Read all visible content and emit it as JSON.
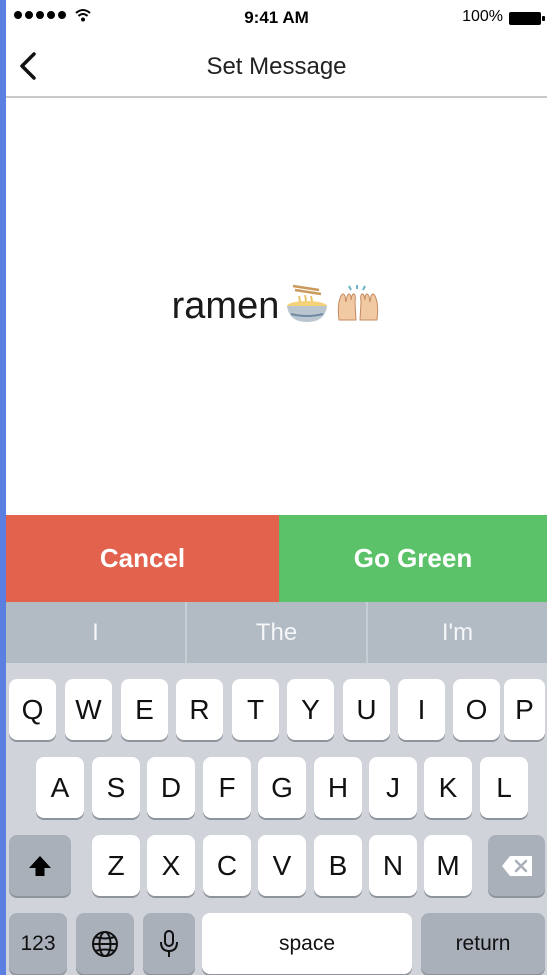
{
  "status_bar": {
    "time": "9:41 AM",
    "battery": "100%",
    "icons": [
      "signal-dots-icon",
      "wifi-icon",
      "battery-icon"
    ]
  },
  "nav": {
    "title": "Set Message",
    "back_icon": "chevron-left-icon"
  },
  "message": {
    "text": "ramen",
    "emojis": [
      "ramen-bowl-emoji",
      "raised-hands-emoji"
    ]
  },
  "actions": {
    "cancel_label": "Cancel",
    "confirm_label": "Go Green"
  },
  "suggestions": [
    "I",
    "The",
    "I'm"
  ],
  "keyboard": {
    "row1": [
      "Q",
      "W",
      "E",
      "R",
      "T",
      "Y",
      "U",
      "I",
      "O",
      "P"
    ],
    "row2": [
      "A",
      "S",
      "D",
      "F",
      "G",
      "H",
      "J",
      "K",
      "L"
    ],
    "row3": [
      "Z",
      "X",
      "C",
      "V",
      "B",
      "N",
      "M"
    ],
    "numbers_label": "123",
    "space_label": "space",
    "return_label": "return",
    "icons": [
      "shift-icon",
      "backspace-icon",
      "globe-icon",
      "microphone-icon"
    ]
  },
  "colors": {
    "cancel": "#e2624e",
    "confirm": "#5bc269",
    "border": "#5a7fe0"
  }
}
